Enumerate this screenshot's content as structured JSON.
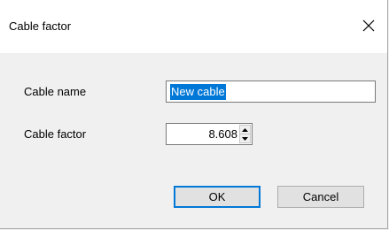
{
  "window": {
    "title": "Cable factor",
    "close_icon": "close-icon"
  },
  "form": {
    "cable_name_label": "Cable name",
    "cable_name_value": "New cable",
    "cable_factor_label": "Cable factor",
    "cable_factor_value": "8.608"
  },
  "buttons": {
    "ok_label": "OK",
    "cancel_label": "Cancel"
  },
  "colors": {
    "selection": "#0078d7",
    "default_button_border": "#0078d7",
    "dialog_background": "#f0f0f0",
    "titlebar_background": "#ffffff"
  }
}
